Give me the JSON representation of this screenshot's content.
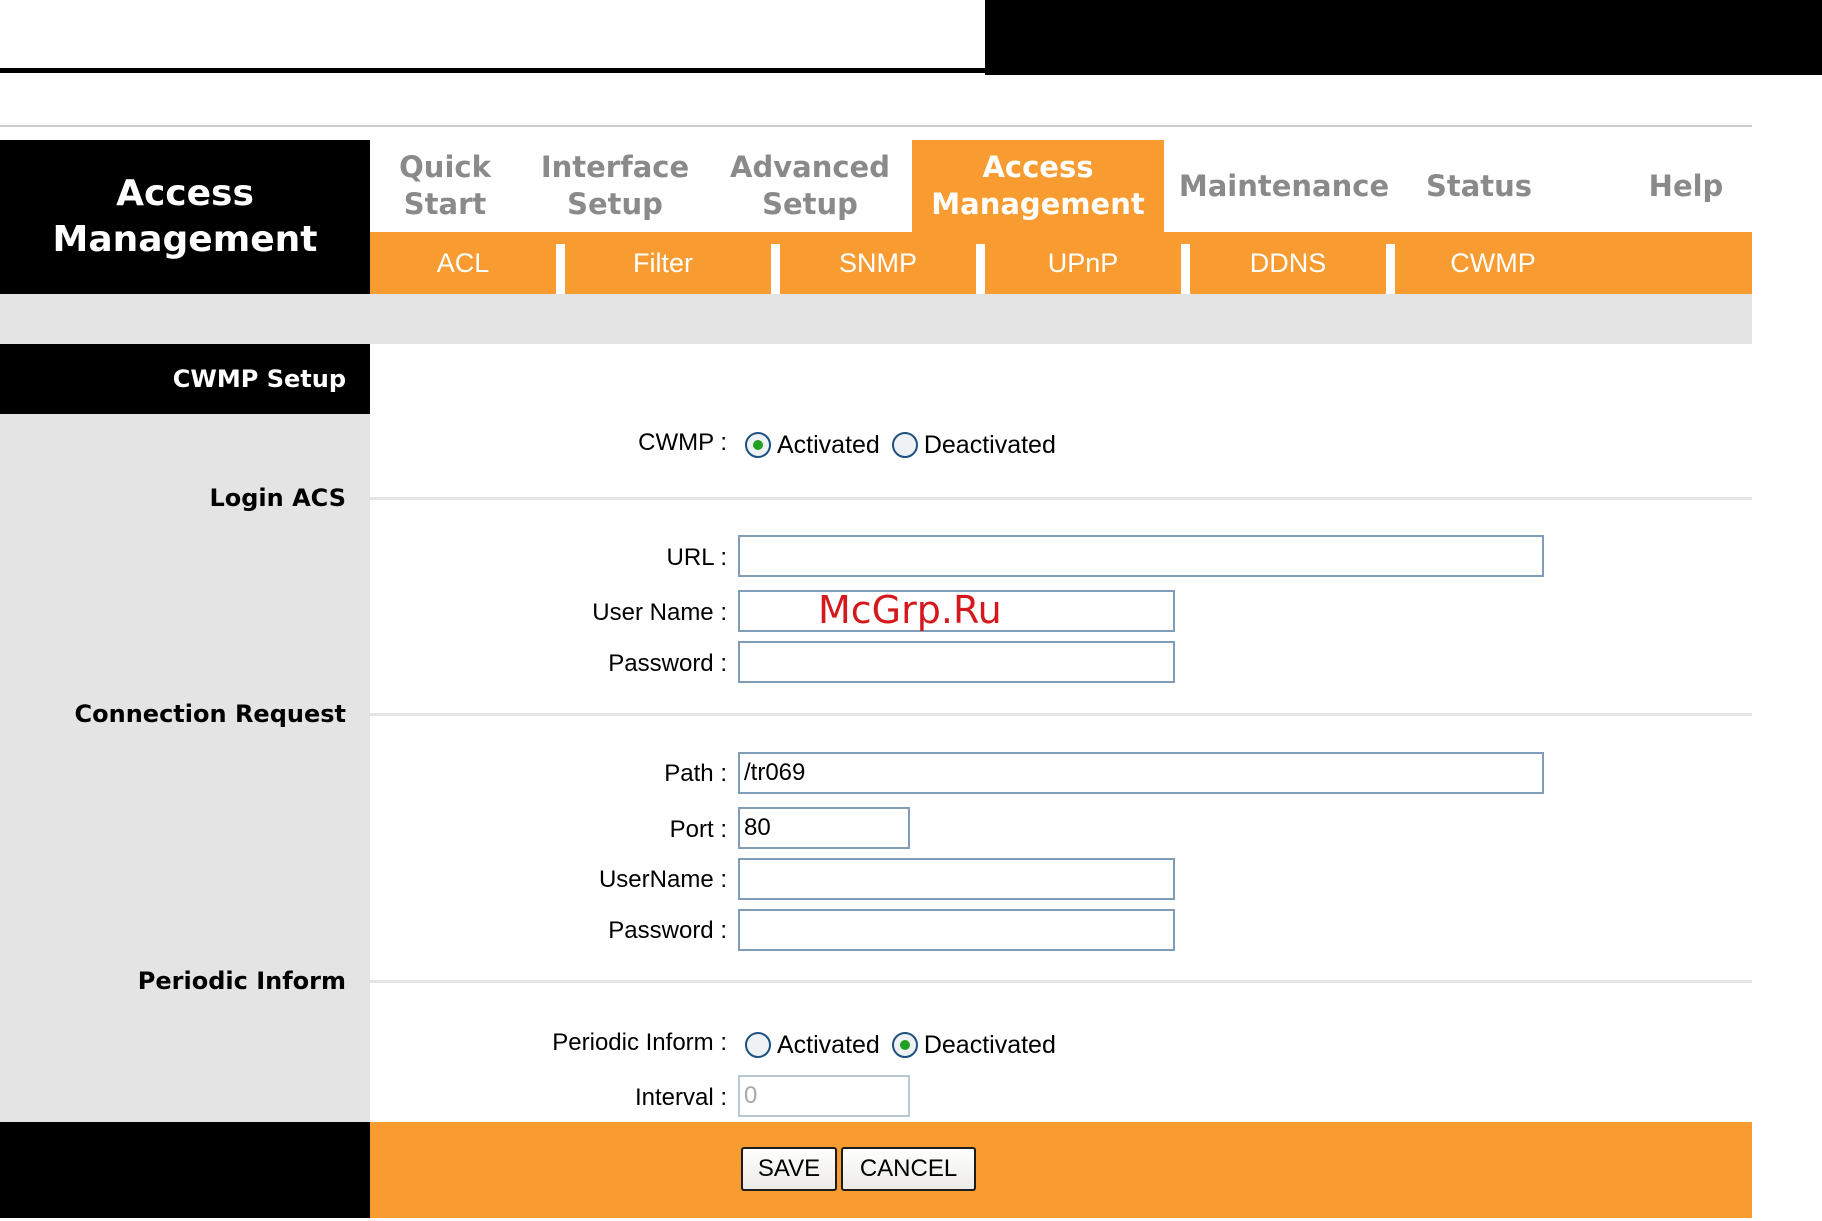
{
  "header": {
    "section_title": "Access\nManagement"
  },
  "nav": {
    "items": [
      {
        "label": "Quick\nStart"
      },
      {
        "label": "Interface\nSetup"
      },
      {
        "label": "Advanced\nSetup"
      },
      {
        "label": "Access\nManagement",
        "active": true
      },
      {
        "label": "Maintenance"
      },
      {
        "label": "Status"
      },
      {
        "label": "Help"
      }
    ]
  },
  "subnav": {
    "items": [
      {
        "label": "ACL"
      },
      {
        "label": "Filter"
      },
      {
        "label": "SNMP"
      },
      {
        "label": "UPnP"
      },
      {
        "label": "DDNS"
      },
      {
        "label": "CWMP",
        "active": true
      }
    ]
  },
  "sections": {
    "cwmp_setup": "CWMP Setup",
    "login_acs": "Login ACS",
    "connection_request": "Connection Request",
    "periodic_inform": "Periodic Inform"
  },
  "form": {
    "cwmp": {
      "label": "CWMP :",
      "options": [
        "Activated",
        "Deactivated"
      ],
      "selected": "Activated"
    },
    "acs_url": {
      "label": "URL :",
      "value": ""
    },
    "acs_username": {
      "label": "User Name :",
      "value": ""
    },
    "acs_password": {
      "label": "Password :",
      "value": ""
    },
    "cr_path": {
      "label": "Path :",
      "value": "/tr069"
    },
    "cr_port": {
      "label": "Port :",
      "value": "80"
    },
    "cr_username": {
      "label": "UserName :",
      "value": ""
    },
    "cr_password": {
      "label": "Password :",
      "value": ""
    },
    "periodic_inform": {
      "label": "Periodic Inform :",
      "options": [
        "Activated",
        "Deactivated"
      ],
      "selected": "Deactivated"
    },
    "interval": {
      "label": "Interval :",
      "value": "0",
      "disabled": true
    }
  },
  "buttons": {
    "save": "SAVE",
    "cancel": "CANCEL"
  },
  "watermark": "McGrp.Ru",
  "colors": {
    "accent": "#f89c32",
    "black": "#000000",
    "panel_grey": "#e4e4e4",
    "nav_text": "#8a8a8a",
    "input_border": "#7f9db9",
    "radio_selected": "#21a121",
    "watermark": "#d4191e"
  }
}
